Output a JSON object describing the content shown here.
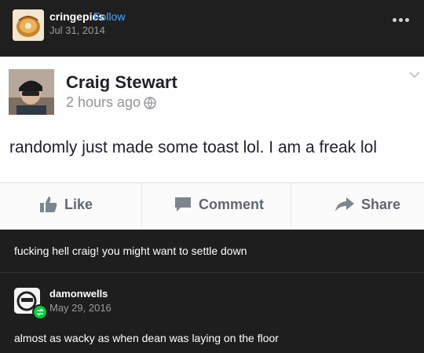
{
  "post": {
    "blog_name": "cringepics",
    "follow_label": "Follow",
    "date": "Jul 31, 2014"
  },
  "facebook": {
    "name": "Craig Stewart",
    "time": "2 hours ago",
    "status": "randomly just made some toast lol. I am a freak lol",
    "actions": {
      "like": "Like",
      "comment": "Comment",
      "share": "Share"
    }
  },
  "caption": "fucking hell craig! you might want to settle down",
  "reblog": {
    "blog_name": "damonwells",
    "date": "May 29, 2016",
    "text": "almost as wacky as when dean was laying on the floor"
  },
  "icons": {
    "more": "ellipsis-icon",
    "globe": "globe-icon",
    "like": "thumbs-up-icon",
    "comment": "comment-icon",
    "share": "share-arrow-icon",
    "reblog": "reblog-icon"
  },
  "colors": {
    "background": "#1e1e1e",
    "follow": "#4aa8ff",
    "reblog_badge": "#00cf35"
  }
}
